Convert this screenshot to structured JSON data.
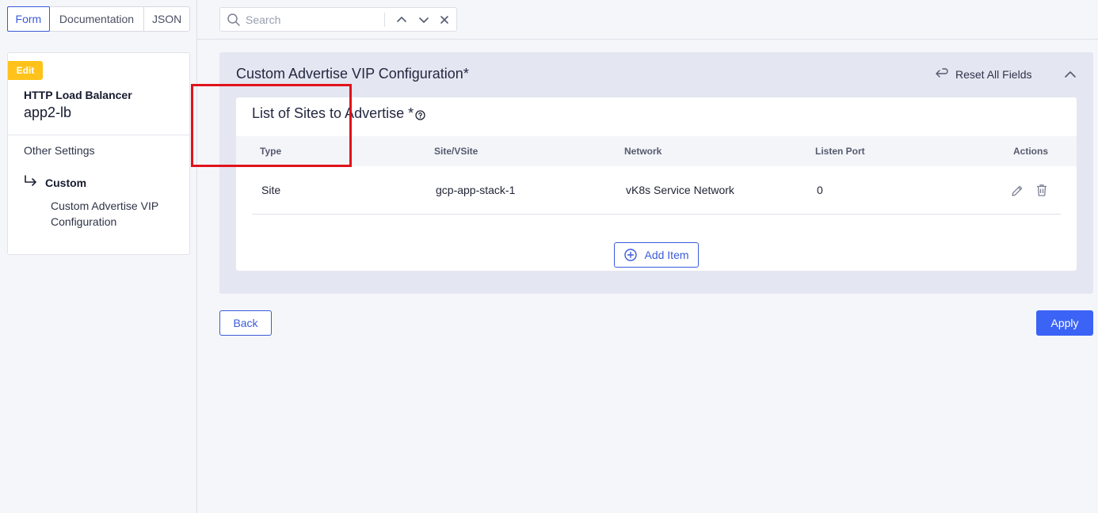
{
  "view_tabs": {
    "form": "Form",
    "documentation": "Documentation",
    "json": "JSON"
  },
  "sidebar": {
    "badge": "Edit",
    "object_type": "HTTP Load Balancer",
    "object_name": "app2-lb",
    "nav_other": "Other Settings",
    "nav_custom": "Custom",
    "nav_sub": "Custom Advertise VIP Configuration"
  },
  "search": {
    "placeholder": "Search",
    "value": ""
  },
  "section": {
    "title": "Custom Advertise VIP Configuration*",
    "reset_label": "Reset All Fields",
    "list_title": "List of Sites to Advertise *",
    "columns": [
      "Type",
      "Site/VSite",
      "Network",
      "Listen Port",
      "Actions"
    ],
    "rows": [
      {
        "type": "Site",
        "site": "gcp-app-stack-1",
        "network": "vK8s Service Network",
        "port": "0"
      }
    ],
    "add_item": "Add Item"
  },
  "footer": {
    "back": "Back",
    "apply": "Apply"
  },
  "colors": {
    "accent": "#3b5bdb",
    "apply": "#3b63f6",
    "badge": "#ffc21a",
    "highlight": "#e0131b"
  }
}
